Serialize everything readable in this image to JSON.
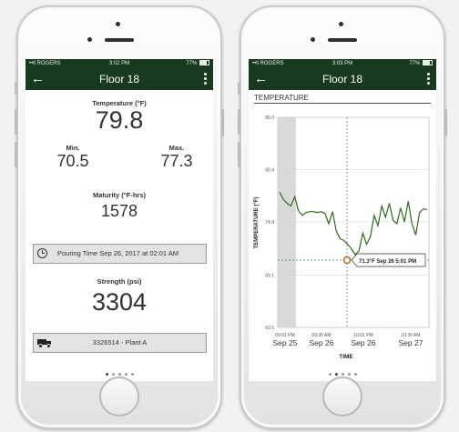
{
  "left_phone": {
    "status": {
      "carrier": "••ll ROGERS",
      "time": "3:02 PM",
      "battery": "77%"
    },
    "nav": {
      "back_icon": "arrow-left-icon",
      "title": "Floor 18",
      "menu_icon": "more-vertical-icon"
    },
    "temperature": {
      "label": "Temperature (°F)",
      "value": "79.8"
    },
    "min": {
      "label": "Min.",
      "value": "70.5"
    },
    "max": {
      "label": "Max.",
      "value": "77.3"
    },
    "maturity": {
      "label": "Maturity (°F-hrs)",
      "value": "1578"
    },
    "pouring": {
      "icon": "clock-icon",
      "text": "Pouring Time Sep 26, 2017 at 02:01 AM"
    },
    "strength": {
      "label": "Strength (psi)",
      "value": "3304"
    },
    "truck": {
      "icon": "truck-icon",
      "text": "3326514 - Plant A"
    },
    "pager": {
      "count": 5,
      "active": 0
    }
  },
  "right_phone": {
    "status": {
      "carrier": "••ll ROGERS",
      "time": "3:03 PM",
      "battery": "77%"
    },
    "nav": {
      "back_icon": "arrow-left-icon",
      "title": "Floor 18",
      "menu_icon": "more-vertical-icon"
    },
    "pager": {
      "count": 5,
      "active": 1
    }
  },
  "chart_data": {
    "type": "line",
    "title": "TEMPERATURE",
    "xlabel": "TIME",
    "ylabel": "TEMPERATURE (°F)",
    "ylim": [
      63.5,
      86.0
    ],
    "y_ticks": [
      "86.0",
      "80.4",
      "74.8",
      "69.1",
      "63.5"
    ],
    "x_ticks": [
      {
        "time": "09:01 PM",
        "date": "Sep 25"
      },
      {
        "time": "09:30 AM",
        "date": "Sep 26"
      },
      {
        "time": "10:01 PM",
        "date": "Sep 26"
      },
      {
        "time": "10:30 AM",
        "date": "Sep 27"
      }
    ],
    "tooltip": "71.3°F Sep 26 5:01 PM",
    "series": [
      {
        "values": [
          78.0,
          77.2,
          76.8,
          76.5,
          77.5,
          76.0,
          75.5,
          75.8,
          75.9,
          75.9,
          75.8,
          75.9,
          75.7,
          74.6,
          75.9,
          73.8,
          73.0,
          72.8,
          72.4,
          71.9,
          71.3,
          71.7,
          73.6,
          72.4,
          73.2,
          75.5,
          74.4,
          76.5,
          75.3,
          76.8,
          75.0,
          74.6,
          76.3,
          74.8,
          77.0,
          74.6,
          73.4,
          75.8,
          76.2,
          76.1
        ]
      }
    ]
  },
  "colors": {
    "brand": "#173a1f",
    "line": "#2e6b1c",
    "marker": "#b06a20"
  }
}
